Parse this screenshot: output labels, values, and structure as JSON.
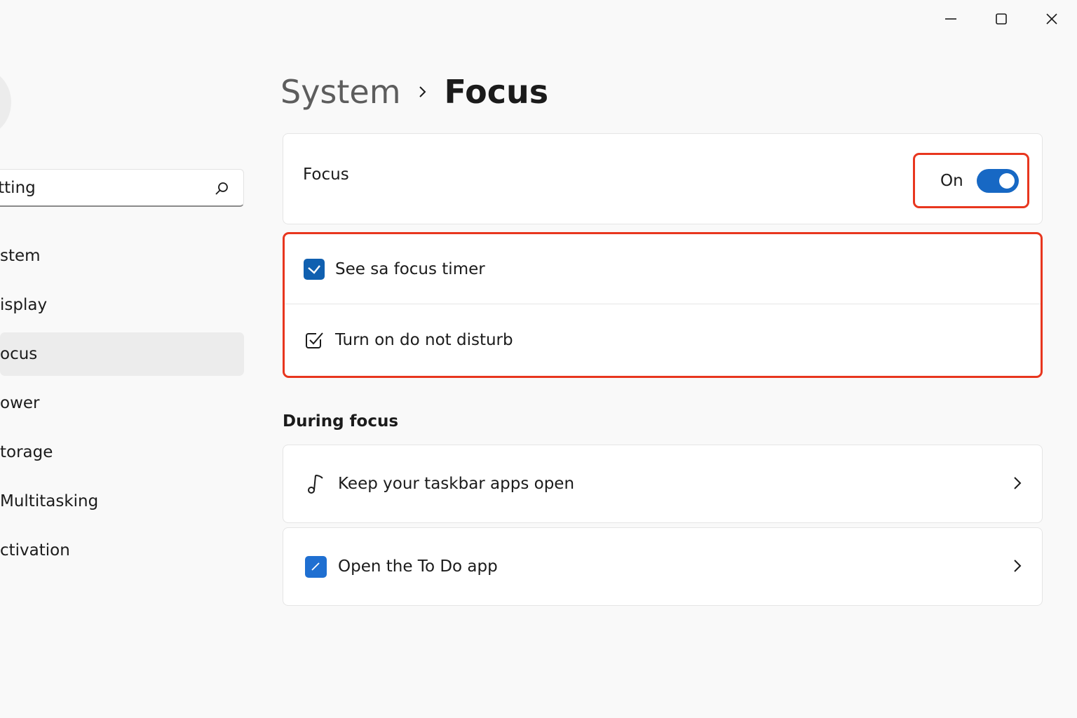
{
  "window_controls": {
    "minimize": "minimize-icon",
    "maximize": "maximize-icon",
    "close": "close-icon"
  },
  "sidebar": {
    "search": {
      "value": "etting",
      "icon": "search-icon"
    },
    "items": [
      {
        "label": "stem",
        "active": false
      },
      {
        "label": "isplay",
        "active": false
      },
      {
        "label": "ocus",
        "active": true
      },
      {
        "label": "ower",
        "active": false
      },
      {
        "label": "torage",
        "active": false
      },
      {
        "label": "Multitasking",
        "active": false
      },
      {
        "label": "ctivation",
        "active": false
      }
    ]
  },
  "breadcrumb": {
    "parent": "System",
    "current": "Focus"
  },
  "focus_card": {
    "label": "Focus",
    "toggle_state": "On",
    "toggle_on": true
  },
  "options": [
    {
      "label": "See sa focus timer",
      "checked": true,
      "icon": "checkbox-checked-icon"
    },
    {
      "label": "Turn on do not disturb",
      "checked": false,
      "icon": "checkbox-outline-icon"
    }
  ],
  "during_focus": {
    "title": "During focus",
    "items": [
      {
        "label": "Keep your taskbar apps open",
        "icon": "music-note-icon"
      },
      {
        "label": "Open the To Do app",
        "icon": "todo-app-icon"
      }
    ]
  },
  "colors": {
    "accent": "#1768c4",
    "highlight": "#e8361e",
    "background": "#f9f9f9"
  }
}
